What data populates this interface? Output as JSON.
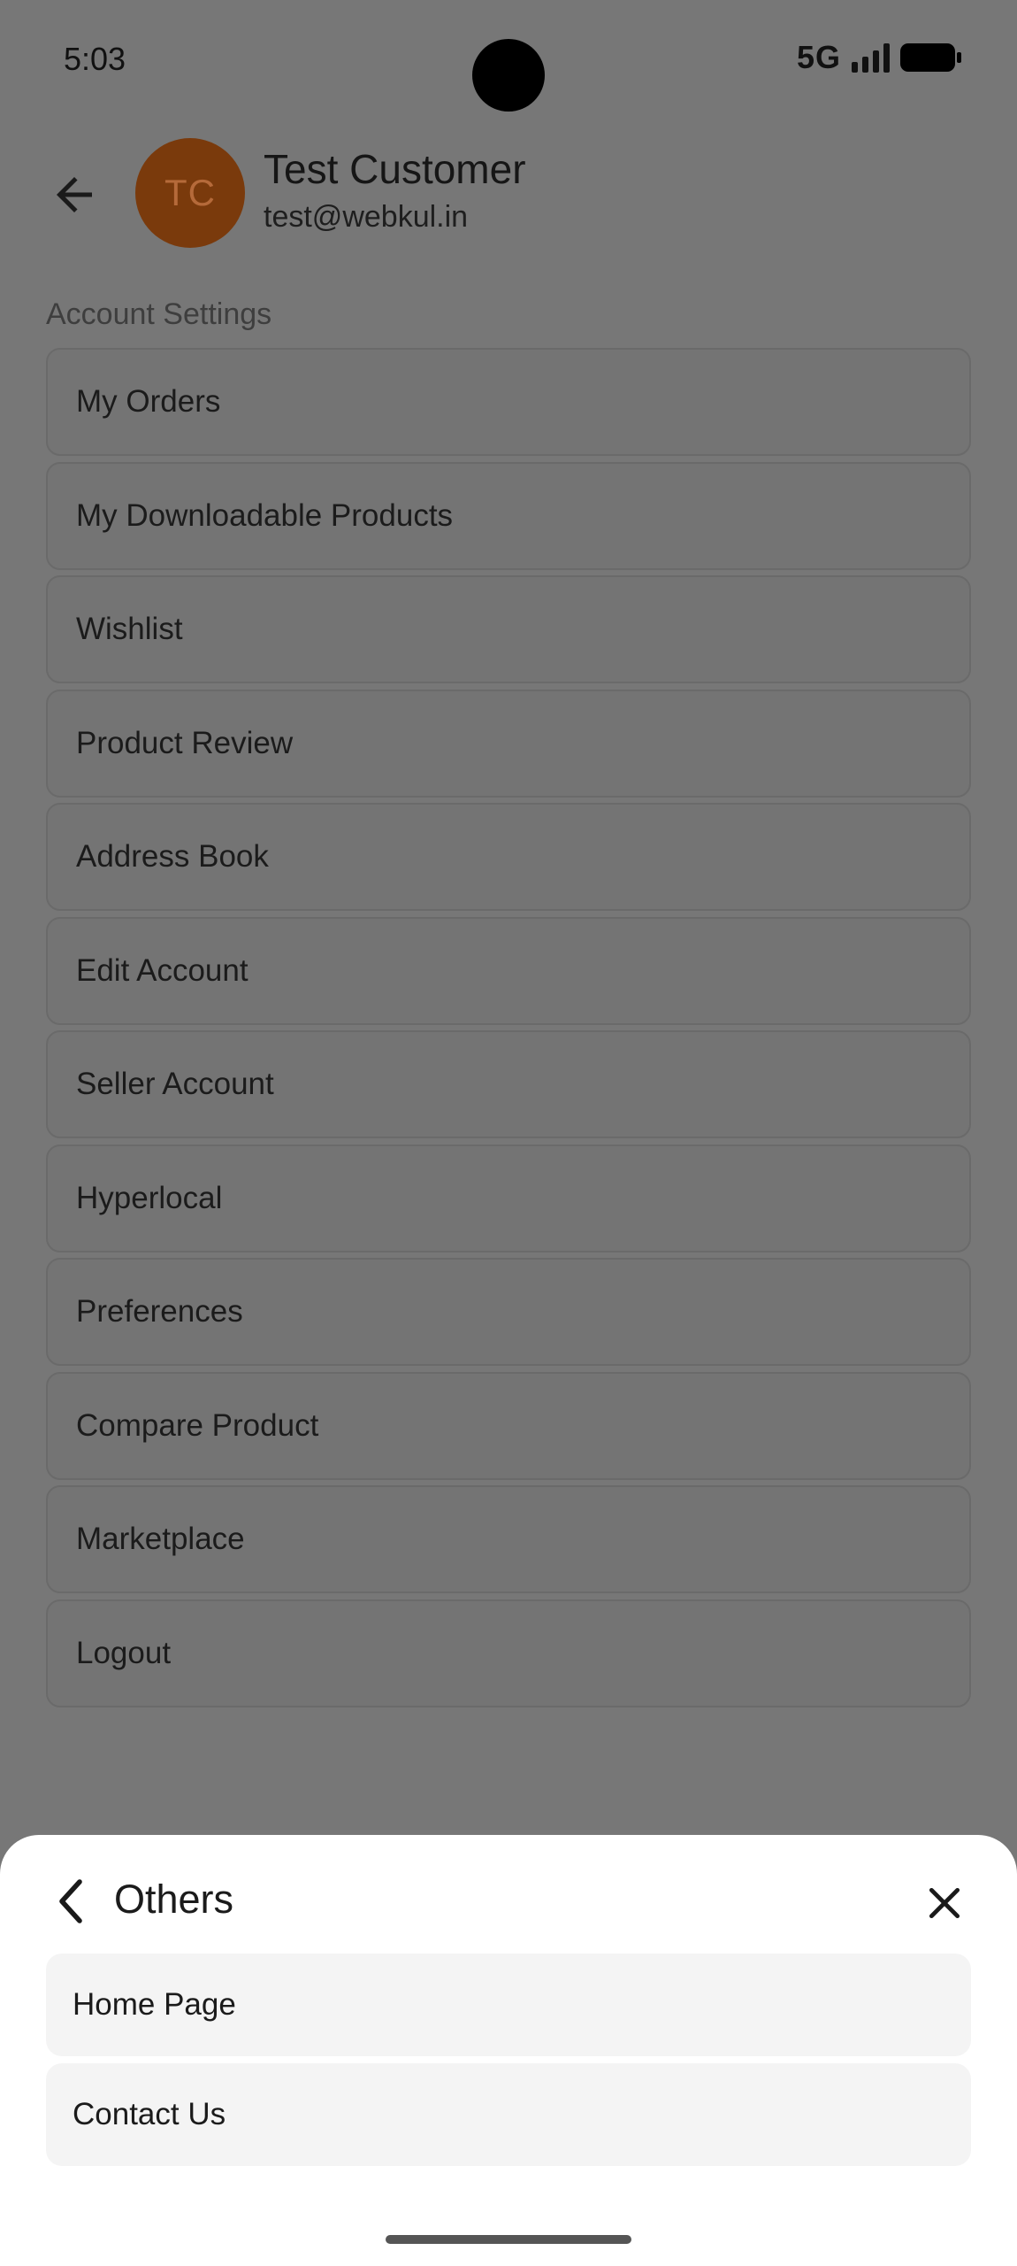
{
  "status_bar": {
    "time": "5:03",
    "network": "5G"
  },
  "profile": {
    "initials": "TC",
    "name": "Test Customer",
    "email": "test@webkul.in"
  },
  "account_settings": {
    "title": "Account Settings",
    "items": [
      "My Orders",
      "My Downloadable Products",
      "Wishlist",
      "Product Review",
      "Address Book",
      "Edit Account",
      "Seller Account",
      "Hyperlocal",
      "Preferences",
      "Compare Product",
      "Marketplace",
      "Logout"
    ]
  },
  "sheet": {
    "title": "Others",
    "items": [
      "Home Page",
      "Contact Us"
    ]
  },
  "colors": {
    "avatar_bg": "#b5510f",
    "overlay": "#777777",
    "sheet_bg": "#ffffff"
  },
  "icons": {
    "back": "arrow-left-icon",
    "sheet_back": "chevron-left-icon",
    "close": "close-icon"
  }
}
